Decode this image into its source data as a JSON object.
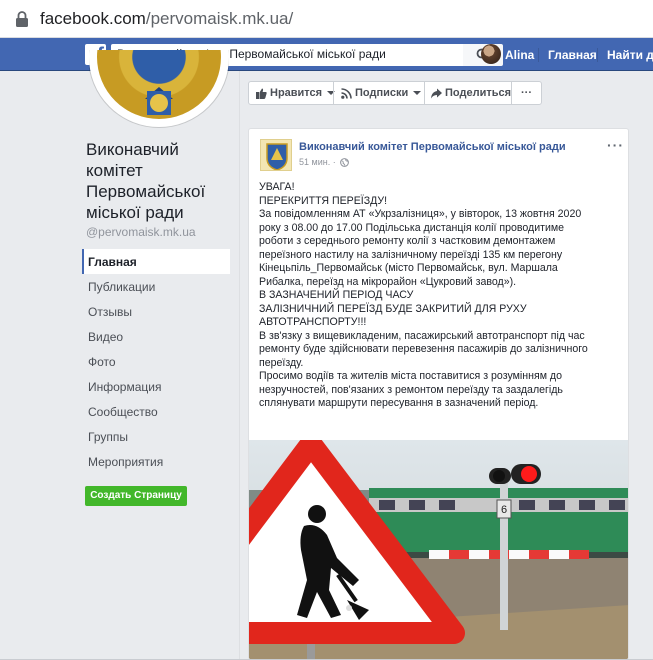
{
  "browser": {
    "url_host": "facebook.com",
    "url_path": "/pervomaisk.mk.ua/"
  },
  "topnav": {
    "search_value": "Виконавчий комітет Первомайської міської ради",
    "user_name": "Alina",
    "home_label": "Главная",
    "find_label": "Найти дру"
  },
  "page": {
    "name_lines": [
      "Виконавчий",
      "комітет",
      "Первомайської",
      "міської ради"
    ],
    "handle": "@pervomaisk.mk.ua",
    "menu": [
      "Главная",
      "Публикации",
      "Отзывы",
      "Видео",
      "Фото",
      "Информация",
      "Сообщество",
      "Группы",
      "Мероприятия"
    ],
    "create_button": "Создать Страницу"
  },
  "actions": {
    "like": "Нравится",
    "follow": "Подписки",
    "share": "Поделиться",
    "more": "···"
  },
  "post": {
    "author": "Виконавчий комітет Первомайської міської ради",
    "time": "51 мин. ·",
    "more": "···",
    "lines": [
      "УВАГА!",
      "ПЕРЕКРИТТЯ ПЕРЕЇЗДУ!",
      "За повідомленням АТ «Укрзалізниця», у вівторок, 13 жовтня 2020",
      "року з 08.00 до 17.00 Подільська дистанція колії проводитиме",
      "роботи з середнього ремонту колії з частковим демонтажем",
      "переїзного настилу на залізничному переїзді 135 км перегону",
      "Кінецьпіль_Первомайськ (місто Первомайськ, вул. Маршала",
      "Рибалка, переїзд на мікрорайон «Цукровий завод»).",
      "В ЗАЗНАЧЕНИЙ ПЕРІОД ЧАСУ",
      "ЗАЛІЗНИЧНИЙ ПЕРЕЇЗД БУДЕ ЗАКРИТИЙ ДЛЯ РУХУ",
      "АВТОТРАНСПОРТУ!!!",
      "В зв'язку з вищевикладеним, пасажирський автотранспорт під час",
      "ремонту буде здійснювати перевезення пасажирів до залізничного",
      "переїзду.",
      "Просимо водіїв та жителів міста поставитися з розумінням до",
      "незручностей, пов'язаних з ремонтом переїзду та заздалегідь",
      "сплянувати маршрути пересування в зазначений період."
    ],
    "image_train_number": "6"
  },
  "colors": {
    "fb_blue": "#4267b2",
    "link_blue": "#385898",
    "create_green": "#42b72a",
    "sign_red": "#d32f2f"
  }
}
